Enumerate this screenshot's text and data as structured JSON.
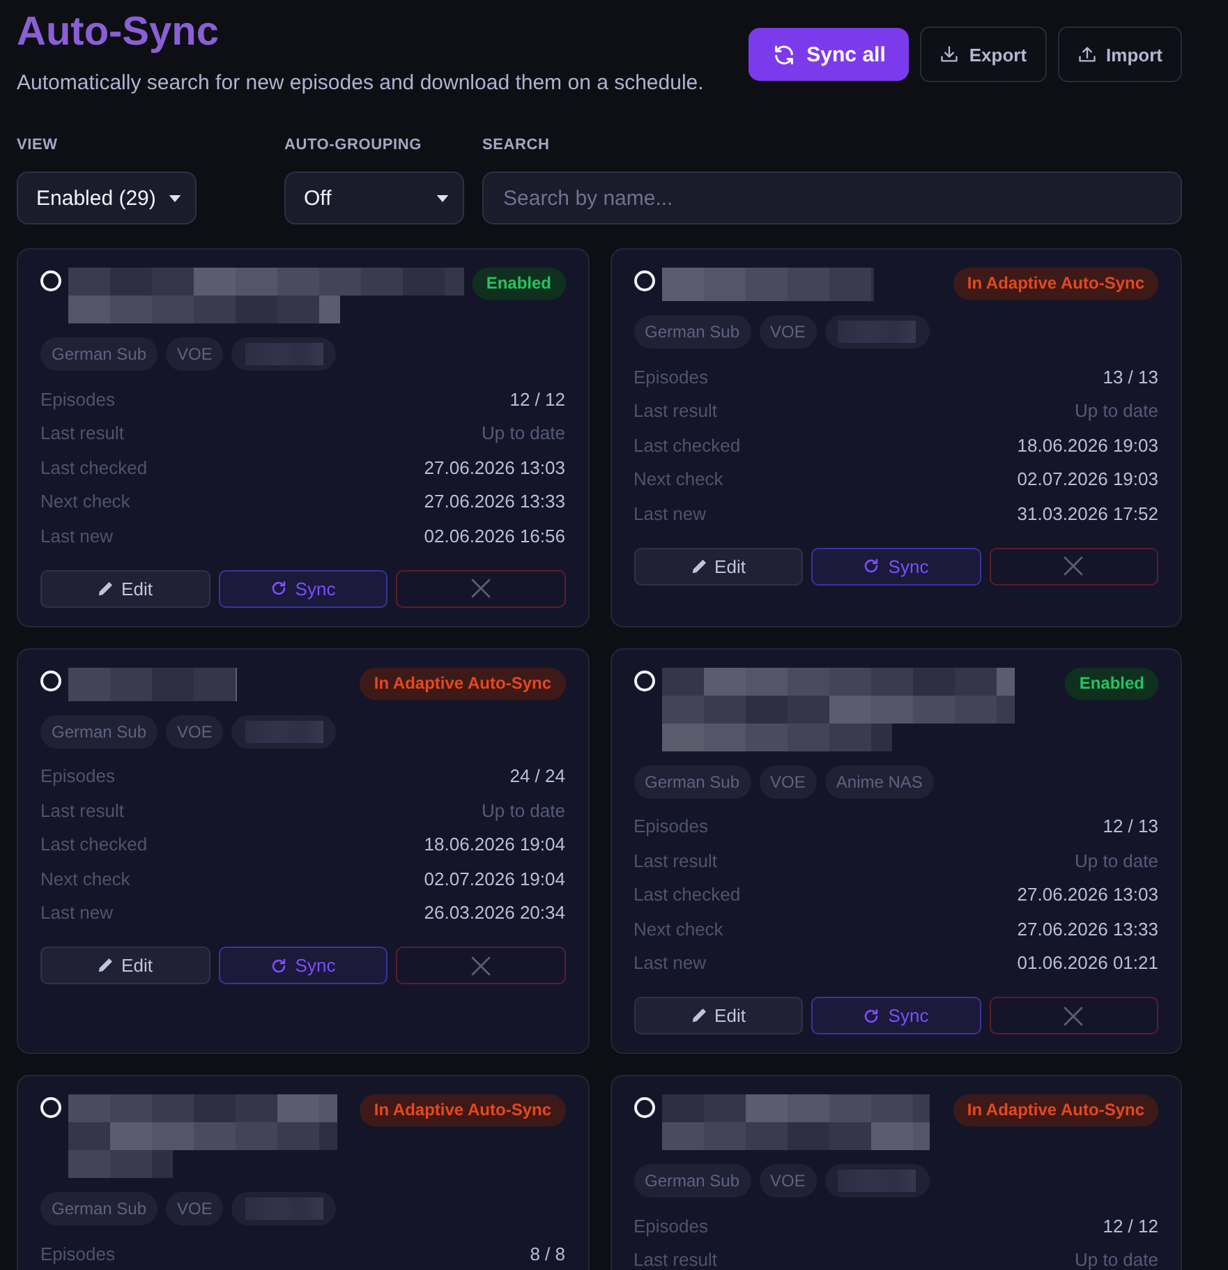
{
  "header": {
    "title": "Auto-Sync",
    "subtitle": "Automatically search for new episodes and download them on a schedule.",
    "actions": [
      {
        "kind": "sync",
        "label": "Sync all"
      },
      {
        "kind": "export",
        "label": "Export"
      },
      {
        "kind": "import",
        "label": "Import"
      }
    ]
  },
  "filters": [
    {
      "kind": "select",
      "label": "VIEW",
      "value": "Enabled (29)"
    },
    {
      "kind": "select",
      "label": "AUTO-GROUPING",
      "value": "Off"
    },
    {
      "kind": "search",
      "label": "SEARCH",
      "placeholder": "Search by name..."
    }
  ],
  "cards": [
    {
      "checked": false,
      "title": {
        "kind": "pixelated"
      },
      "status": {
        "kind": "enabled",
        "label": "Enabled"
      },
      "tags": [
        {
          "kind": "text",
          "label": "German Sub"
        },
        {
          "kind": "text",
          "label": "VOE"
        },
        {
          "kind": "pixelated"
        }
      ],
      "stats": [
        {
          "kind": "count",
          "label": "Episodes",
          "value": "12 / 12"
        },
        {
          "kind": "result",
          "label": "Last result",
          "value": "Up to date"
        },
        {
          "kind": "date",
          "label": "Last checked",
          "value": "27.06.2026 13:03"
        },
        {
          "kind": "date",
          "label": "Next check",
          "value": "27.06.2026 13:33"
        },
        {
          "kind": "date",
          "label": "Last new",
          "value": "02.06.2026 16:56"
        }
      ],
      "actions": [
        {
          "kind": "edit",
          "label": "Edit"
        },
        {
          "kind": "sync",
          "label": "Sync"
        },
        {
          "kind": "delete"
        }
      ]
    },
    {
      "checked": false,
      "title": {
        "kind": "pixelated"
      },
      "status": {
        "kind": "adaptive",
        "label": "In Adaptive Auto-Sync"
      },
      "tags": [
        {
          "kind": "text",
          "label": "German Sub"
        },
        {
          "kind": "text",
          "label": "VOE"
        },
        {
          "kind": "pixelated"
        }
      ],
      "stats": [
        {
          "kind": "count",
          "label": "Episodes",
          "value": "13 / 13"
        },
        {
          "kind": "result",
          "label": "Last result",
          "value": "Up to date"
        },
        {
          "kind": "date",
          "label": "Last checked",
          "value": "18.06.2026 19:03"
        },
        {
          "kind": "date",
          "label": "Next check",
          "value": "02.07.2026 19:03"
        },
        {
          "kind": "date",
          "label": "Last new",
          "value": "31.03.2026 17:52"
        }
      ],
      "actions": [
        {
          "kind": "edit",
          "label": "Edit"
        },
        {
          "kind": "sync",
          "label": "Sync"
        },
        {
          "kind": "delete"
        }
      ]
    },
    {
      "checked": false,
      "title": {
        "kind": "pixelated"
      },
      "status": {
        "kind": "adaptive",
        "label": "In Adaptive Auto-Sync"
      },
      "tags": [
        {
          "kind": "text",
          "label": "German Sub"
        },
        {
          "kind": "text",
          "label": "VOE"
        },
        {
          "kind": "pixelated"
        }
      ],
      "stats": [
        {
          "kind": "count",
          "label": "Episodes",
          "value": "24 / 24"
        },
        {
          "kind": "result",
          "label": "Last result",
          "value": "Up to date"
        },
        {
          "kind": "date",
          "label": "Last checked",
          "value": "18.06.2026 19:04"
        },
        {
          "kind": "date",
          "label": "Next check",
          "value": "02.07.2026 19:04"
        },
        {
          "kind": "date",
          "label": "Last new",
          "value": "26.03.2026 20:34"
        }
      ],
      "actions": [
        {
          "kind": "edit",
          "label": "Edit"
        },
        {
          "kind": "sync",
          "label": "Sync"
        },
        {
          "kind": "delete"
        }
      ]
    },
    {
      "checked": false,
      "title": {
        "kind": "pixelated"
      },
      "status": {
        "kind": "enabled",
        "label": "Enabled"
      },
      "tags": [
        {
          "kind": "text",
          "label": "German Sub"
        },
        {
          "kind": "text",
          "label": "VOE"
        },
        {
          "kind": "text",
          "label": "Anime NAS"
        }
      ],
      "stats": [
        {
          "kind": "count",
          "label": "Episodes",
          "value": "12 / 13"
        },
        {
          "kind": "result",
          "label": "Last result",
          "value": "Up to date"
        },
        {
          "kind": "date",
          "label": "Last checked",
          "value": "27.06.2026 13:03"
        },
        {
          "kind": "date",
          "label": "Next check",
          "value": "27.06.2026 13:33"
        },
        {
          "kind": "date",
          "label": "Last new",
          "value": "01.06.2026 01:21"
        }
      ],
      "actions": [
        {
          "kind": "edit",
          "label": "Edit"
        },
        {
          "kind": "sync",
          "label": "Sync"
        },
        {
          "kind": "delete"
        }
      ]
    },
    {
      "checked": false,
      "title": {
        "kind": "pixelated"
      },
      "status": {
        "kind": "adaptive",
        "label": "In Adaptive Auto-Sync"
      },
      "tags": [
        {
          "kind": "text",
          "label": "German Sub"
        },
        {
          "kind": "text",
          "label": "VOE"
        },
        {
          "kind": "pixelated"
        }
      ],
      "stats": [
        {
          "kind": "count",
          "label": "Episodes",
          "value": "8 / 8"
        }
      ]
    },
    {
      "checked": false,
      "title": {
        "kind": "pixelated"
      },
      "status": {
        "kind": "adaptive",
        "label": "In Adaptive Auto-Sync"
      },
      "tags": [
        {
          "kind": "text",
          "label": "German Sub"
        },
        {
          "kind": "text",
          "label": "VOE"
        },
        {
          "kind": "pixelated"
        }
      ],
      "stats": [
        {
          "kind": "count",
          "label": "Episodes",
          "value": "12 / 12"
        },
        {
          "kind": "result",
          "label": "Last result",
          "value": "Up to date"
        }
      ]
    }
  ]
}
